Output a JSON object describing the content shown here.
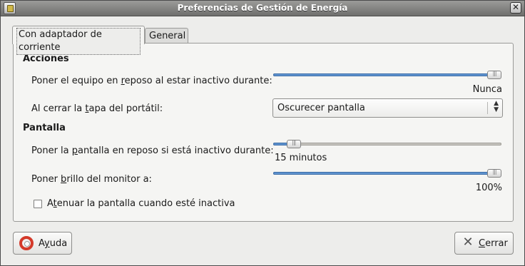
{
  "window": {
    "title": "Preferencias de Gestión de Energía",
    "app_icon": "power-preferences-icon",
    "close_icon": "close-icon"
  },
  "tabs": [
    {
      "label": "Con adaptador de corriente",
      "active": true
    },
    {
      "label": "General",
      "active": false
    }
  ],
  "acciones": {
    "heading": "Acciones",
    "sleep_label": "Poner el equipo en reposo al estar inactivo durante:",
    "sleep_value": "Nunca",
    "sleep_level": 1.0,
    "lid_label": "Al cerrar la tapa del portátil:",
    "lid_option": "Oscurecer pantalla"
  },
  "pantalla": {
    "heading": "Pantalla",
    "display_sleep_label": "Poner la pantalla en reposo si está inactivo durante:",
    "display_sleep_value": "15 minutos",
    "display_sleep_level": 0.09,
    "brightness_label": "Poner brillo del monitor a:",
    "brightness_value": "100%",
    "brightness_level": 1.0,
    "dim_label": "Atenuar la pantalla cuando esté inactiva",
    "dim_checked": false
  },
  "buttons": {
    "help": "Ayuda",
    "help_icon": "help-lifebuoy-icon",
    "close": "Cerrar",
    "close_icon": "close-x-icon"
  },
  "colors": {
    "slider_fill": "#5f93cf",
    "help_icon_red": "#d43a2a"
  }
}
